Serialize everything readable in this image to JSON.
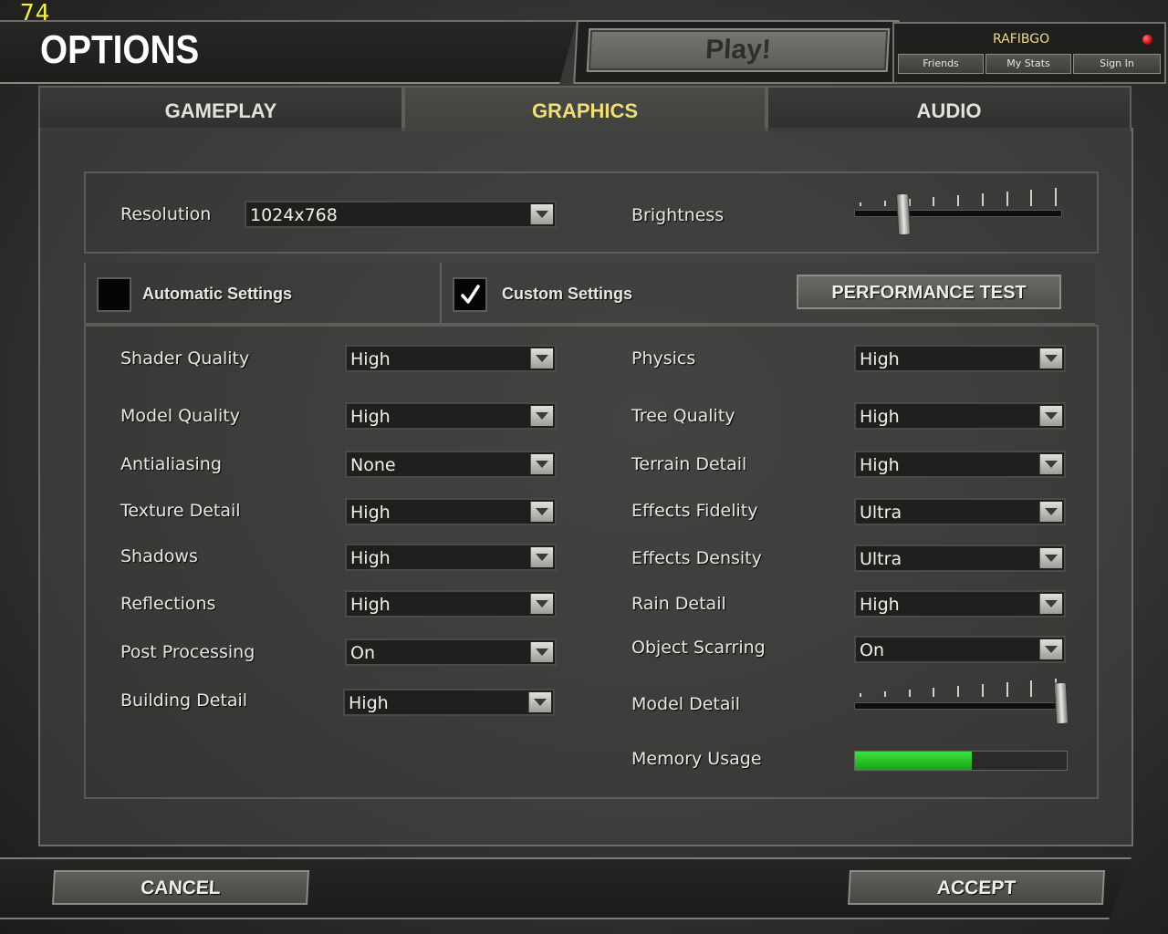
{
  "hud": {
    "fps": "74"
  },
  "header": {
    "title": "OPTIONS",
    "play_label": "Play!"
  },
  "account": {
    "username": "RAFIBGO",
    "buttons": [
      "Friends",
      "My Stats",
      "Sign In"
    ]
  },
  "tabs": [
    {
      "label": "GAMEPLAY",
      "active": false
    },
    {
      "label": "GRAPHICS",
      "active": true
    },
    {
      "label": "AUDIO",
      "active": false
    }
  ],
  "display": {
    "resolution_label": "Resolution",
    "resolution_value": "1024x768",
    "brightness_label": "Brightness",
    "brightness_level": 0.22
  },
  "presets": {
    "automatic_label": "Automatic Settings",
    "automatic_checked": false,
    "custom_label": "Custom Settings",
    "custom_checked": true,
    "performance_test_label": "PERFORMANCE TEST"
  },
  "settings_left": [
    {
      "label": "Shader Quality",
      "value": "High"
    },
    {
      "label": "Model Quality",
      "value": "High"
    },
    {
      "label": "Antialiasing",
      "value": "None"
    },
    {
      "label": "Texture Detail",
      "value": "High"
    },
    {
      "label": "Shadows",
      "value": "High"
    },
    {
      "label": "Reflections",
      "value": "High"
    },
    {
      "label": "Post Processing",
      "value": "On"
    },
    {
      "label": "Building Detail",
      "value": "High"
    }
  ],
  "settings_right": [
    {
      "label": "Physics",
      "value": "High"
    },
    {
      "label": "Tree Quality",
      "value": "High"
    },
    {
      "label": "Terrain Detail",
      "value": "High"
    },
    {
      "label": "Effects Fidelity",
      "value": "Ultra"
    },
    {
      "label": "Effects Density",
      "value": "Ultra"
    },
    {
      "label": "Rain Detail",
      "value": "High"
    },
    {
      "label": "Object Scarring",
      "value": "On"
    }
  ],
  "model_detail": {
    "label": "Model Detail",
    "level": 1.0
  },
  "memory_usage": {
    "label": "Memory Usage",
    "fraction": 0.55,
    "color": "#2fd02f"
  },
  "footer": {
    "cancel_label": "CANCEL",
    "accept_label": "ACCEPT"
  }
}
